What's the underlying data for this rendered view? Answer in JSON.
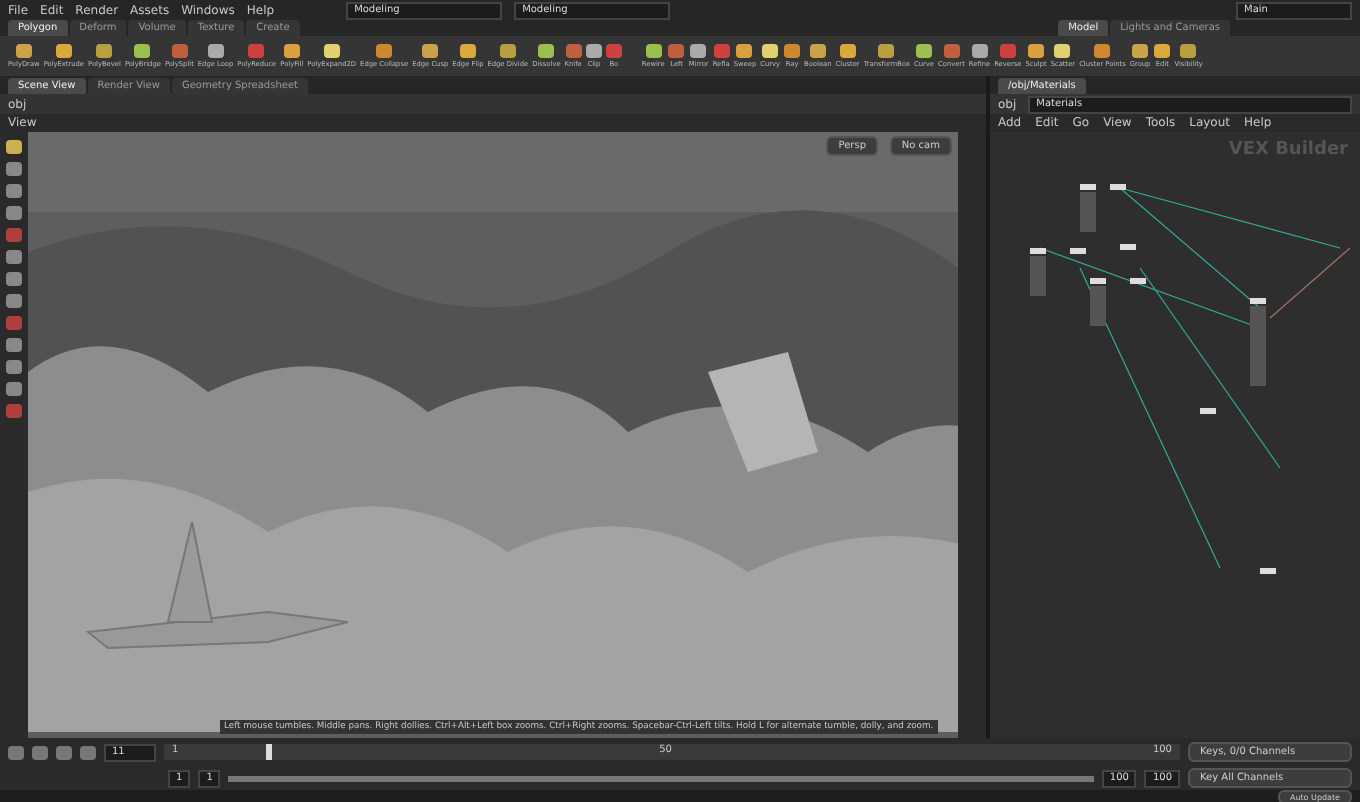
{
  "menu": [
    "File",
    "Edit",
    "Render",
    "Assets",
    "Windows",
    "Help"
  ],
  "desktops": [
    "Modeling",
    "Modeling"
  ],
  "context": "Main",
  "shelf_tabs": [
    {
      "label": "Polygon",
      "selected": true
    },
    {
      "label": "Deform",
      "selected": false
    },
    {
      "label": "Volume",
      "selected": false
    },
    {
      "label": "Texture",
      "selected": false
    },
    {
      "label": "Create",
      "selected": false
    }
  ],
  "shelf_tabs_right": [
    {
      "label": "Model",
      "selected": true
    },
    {
      "label": "Lights and Cameras",
      "selected": false
    }
  ],
  "tools": [
    "PolyDraw",
    "PolyExtrude",
    "PolyBevel",
    "PolyBridge",
    "PolySplit",
    "Edge Loop",
    "PolyReduce",
    "PolyFill",
    "PolyExpand2D",
    "Edge Collapse",
    "Edge Cusp",
    "Edge Flip",
    "Edge Divide",
    "Dissolve",
    "Knife",
    "Clip",
    "Bo"
  ],
  "tools_right": [
    "Rewire",
    "Left",
    "Mirror",
    "Refla",
    "Sweep",
    "Curvy",
    "Ray",
    "Boolean",
    "Cluster",
    "TransformBox",
    "Curve",
    "Convert",
    "Refine",
    "Reverse",
    "Sculpt",
    "Scatter",
    "Cluster Points",
    "Group",
    "Edit",
    "Visibility"
  ],
  "pane_tabs": [
    {
      "label": "Scene View",
      "selected": true
    },
    {
      "label": "Render View",
      "selected": false
    },
    {
      "label": "Geometry Spreadsheet",
      "selected": false
    }
  ],
  "path": "obj",
  "viewport": {
    "label": "View",
    "camera": "Persp",
    "display": "No cam",
    "hint": "Left mouse tumbles. Middle pans. Right dollies. Ctrl+Alt+Left box zooms. Ctrl+Right zooms. Spacebar-Ctrl-Left tilts. Hold L for alternate tumble, dolly, and zoom."
  },
  "network": {
    "tab": "/obj/Materials",
    "path": "obj",
    "node": "Materials",
    "menu": [
      "Add",
      "Edit",
      "Go",
      "View",
      "Tools",
      "Layout",
      "Help"
    ],
    "title": "VEX Builder"
  },
  "timeline": {
    "frame": "11",
    "ticks": [
      "1",
      "50",
      "100"
    ],
    "start": "1",
    "start2": "1",
    "end": "100",
    "end2": "100",
    "level": 0.1,
    "range": {
      "level": 1
    }
  },
  "keys": "Keys, 0/0 Channels",
  "key_all": "Key All Channels",
  "auto_update": "Auto Update"
}
